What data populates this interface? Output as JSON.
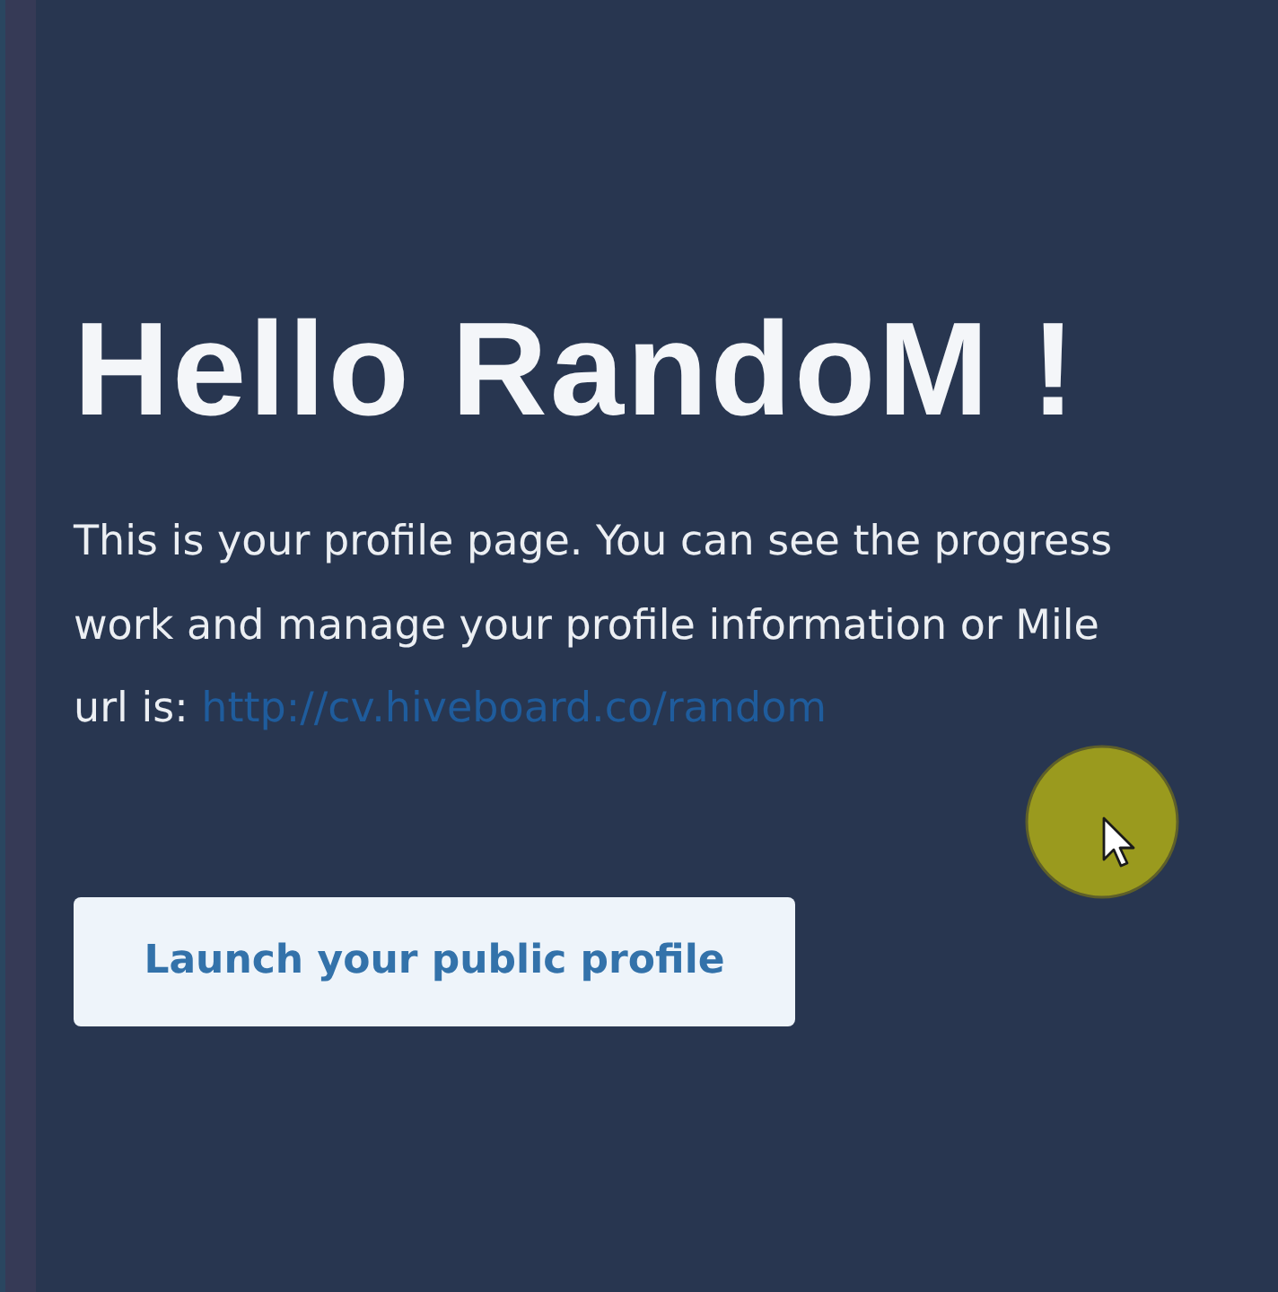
{
  "greeting": {
    "title": "Hello RandoM !"
  },
  "intro": {
    "lines": [
      "This is your profile page. You can see the progress",
      "work and manage your profile information or Mile"
    ],
    "url_label": "url is:",
    "url": "http://cv.hiveboard.co/random"
  },
  "actions": {
    "launch_button": "Launch your public profile"
  }
}
